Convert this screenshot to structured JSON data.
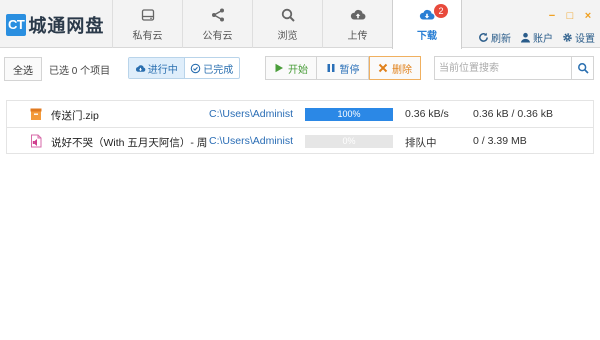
{
  "app": {
    "logo_badge": "CT",
    "logo_text": "城通网盘"
  },
  "tabs": [
    {
      "label": "私有云",
      "icon": "drive-icon"
    },
    {
      "label": "公有云",
      "icon": "share-icon"
    },
    {
      "label": "浏览",
      "icon": "search-icon"
    },
    {
      "label": "上传",
      "icon": "cloud-upload-icon"
    },
    {
      "label": "下载",
      "icon": "cloud-download-icon",
      "active": true,
      "badge": "2"
    }
  ],
  "window_controls": {
    "minimize": "−",
    "maximize": "□",
    "close": "×"
  },
  "header_links": [
    {
      "label": "刷新",
      "icon": "refresh-icon"
    },
    {
      "label": "账户",
      "icon": "user-icon"
    },
    {
      "label": "设置",
      "icon": "gear-icon"
    }
  ],
  "toolbar": {
    "select_all": "全选",
    "selected_text": "已选 0 个项目",
    "filter_running": "进行中",
    "filter_done": "已完成",
    "start": "开始",
    "pause": "暂停",
    "delete": "删除",
    "search_placeholder": "当前位置搜索"
  },
  "colors": {
    "accent": "#2b88e6",
    "start": "#4a9d3a",
    "delete": "#e0801a",
    "badge": "#e84a3c"
  },
  "downloads": [
    {
      "name": "传送门.zip",
      "path": "C:\\Users\\Administ",
      "progress_text": "100%",
      "progress": 1.0,
      "speed": "0.36 kB/s",
      "size": "0.36 kB / 0.36 kB",
      "icon": "archive-icon"
    },
    {
      "name": "说好不哭（With 五月天阿信）- 周",
      "path": "C:\\Users\\Administ",
      "progress_text": "0%",
      "progress": 0.0,
      "speed": "排队中",
      "size": "0 / 3.39 MB",
      "icon": "audio-file-icon"
    }
  ]
}
